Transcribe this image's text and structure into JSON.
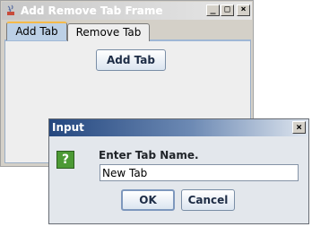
{
  "frame": {
    "title": "Add Remove Tab Frame",
    "buttons": {
      "minimize": "_",
      "maximize": "□",
      "close": "×"
    },
    "tabs": [
      {
        "label": "Add Tab",
        "selected": true
      },
      {
        "label": "Remove Tab",
        "selected": false
      }
    ],
    "panel": {
      "add_button_label": "Add Tab"
    }
  },
  "dialog": {
    "title": "Input",
    "close": "×",
    "icon": "question-icon",
    "icon_glyph": "?",
    "prompt": "Enter Tab Name.",
    "input_value": "New Tab",
    "ok_label": "OK",
    "cancel_label": "Cancel"
  },
  "colors": {
    "dialog_title_start": "#24477f",
    "selected_tab": "#bcd0e6",
    "tab_highlight": "#f5ba48",
    "question_icon": "#4c9a35"
  }
}
